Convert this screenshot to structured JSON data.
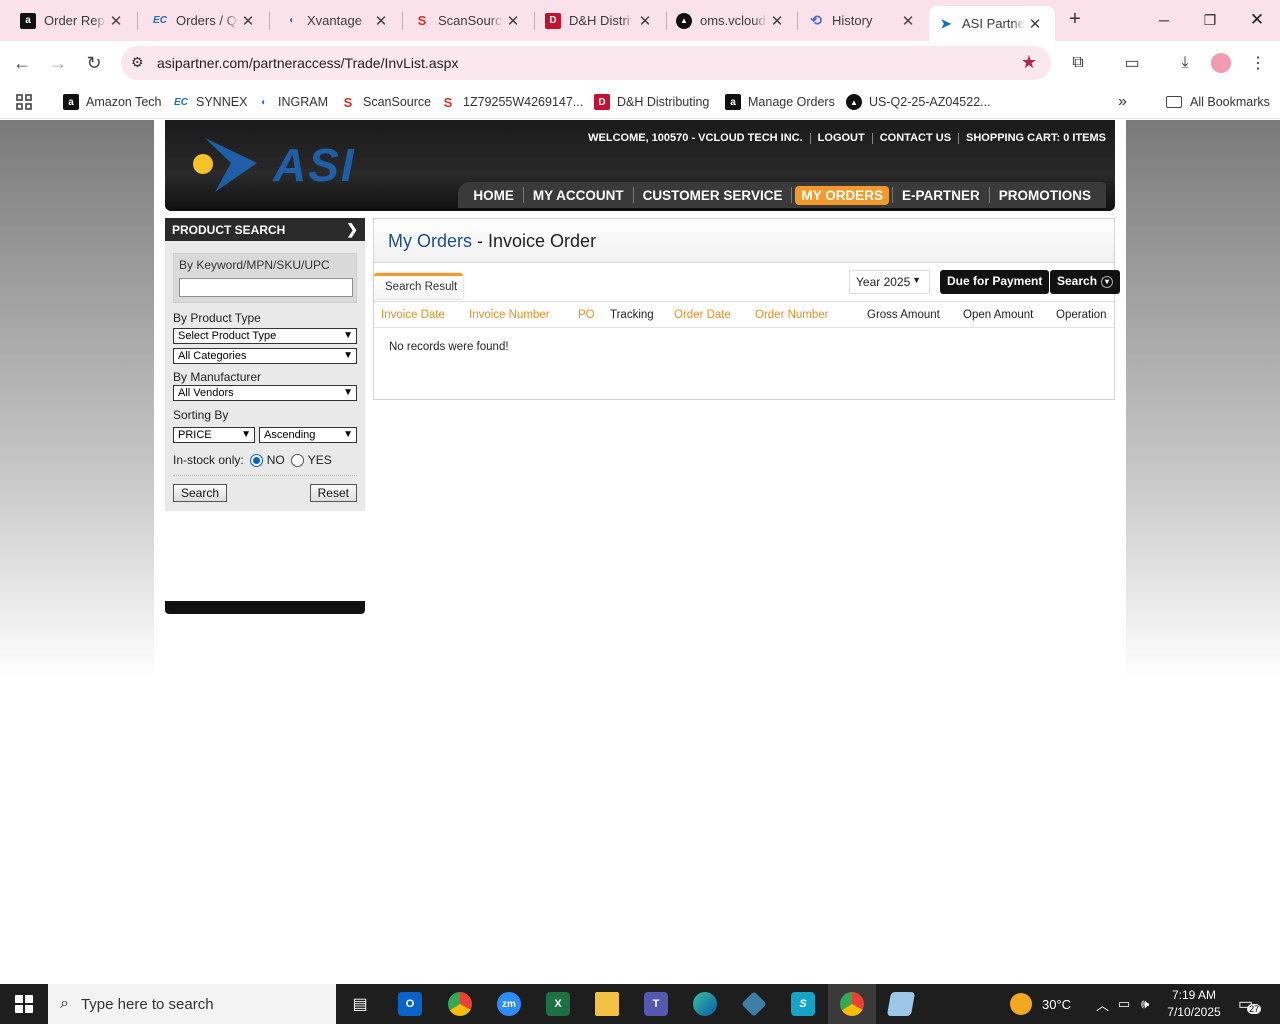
{
  "browser": {
    "tabs": [
      {
        "title": "Order Repo",
        "icon": "amazon-icon",
        "icon_glyph": "a",
        "icon_bg": "#111111",
        "icon_fg": "#ffffff"
      },
      {
        "title": "Orders / Qu",
        "icon": "synnex-icon",
        "icon_glyph": "EC",
        "icon_bg": "transparent",
        "icon_fg": "#1f6fc1"
      },
      {
        "title": "Xvantage",
        "icon": "ingram-icon",
        "icon_glyph": "◖",
        "icon_bg": "transparent",
        "icon_fg": "#1f6fc1"
      },
      {
        "title": "ScanSource",
        "icon": "scansource-icon",
        "icon_glyph": "S",
        "icon_bg": "transparent",
        "icon_fg": "#d2322d"
      },
      {
        "title": "D&H Distri",
        "icon": "dh-icon",
        "icon_glyph": "D",
        "icon_bg": "#c3122f",
        "icon_fg": "#ffffff"
      },
      {
        "title": "oms.vcloud",
        "icon": "oms-icon",
        "icon_glyph": "▲",
        "icon_bg": "#111111",
        "icon_fg": "#ffffff"
      },
      {
        "title": "History",
        "icon": "history-icon",
        "icon_glyph": "⟲",
        "icon_bg": "transparent",
        "icon_fg": "#4a6fd0"
      },
      {
        "title": "ASI Partner",
        "icon": "asi-icon",
        "icon_glyph": "➤",
        "icon_bg": "transparent",
        "icon_fg": "#1f6fc1"
      }
    ],
    "new_tab": "+",
    "url": "asipartner.com/partneraccess/Trade/InvList.aspx",
    "bookmarks": [
      {
        "label": "Amazon Tech",
        "icon": "amazon-icon",
        "glyph": "a",
        "bg": "#111111",
        "fg": "#ffffff"
      },
      {
        "label": "SYNNEX",
        "icon": "synnex-icon",
        "glyph": "EC",
        "bg": "transparent",
        "fg": "#1f6fc1"
      },
      {
        "label": "INGRAM",
        "icon": "ingram-icon",
        "glyph": "◖",
        "bg": "transparent",
        "fg": "#1f6fc1"
      },
      {
        "label": "ScanSource",
        "icon": "scansource-icon",
        "glyph": "S",
        "bg": "transparent",
        "fg": "#d2322d"
      },
      {
        "label": "1Z79255W4269147...",
        "icon": "scansource-icon",
        "glyph": "S",
        "bg": "transparent",
        "fg": "#d2322d"
      },
      {
        "label": "D&H Distributing",
        "icon": "dh-icon",
        "glyph": "D",
        "bg": "#c3122f",
        "fg": "#ffffff"
      },
      {
        "label": "Manage Orders",
        "icon": "amazon-icon",
        "glyph": "a",
        "bg": "#111111",
        "fg": "#ffffff"
      },
      {
        "label": "US-Q2-25-AZ04522...",
        "icon": "oms-icon",
        "glyph": "▲",
        "bg": "#111111",
        "fg": "#ffffff"
      }
    ],
    "more_bookmarks": "»",
    "all_bookmarks": "All Bookmarks"
  },
  "site": {
    "welcome": "WELCOME, 100570 - VCLOUD TECH INC.",
    "logout": "LOGOUT",
    "contact": "CONTACT US",
    "cart": "SHOPPING CART: 0 ITEMS",
    "logo_text": "ASI",
    "nav": [
      "HOME",
      "MY ACCOUNT",
      "CUSTOMER SERVICE",
      "MY ORDERS",
      "E-PARTNER",
      "PROMOTIONS"
    ],
    "nav_active": "MY ORDERS",
    "accent_color": "#f39a2b",
    "brand_blue": "#1f5fa8"
  },
  "sidebar": {
    "title": "PRODUCT SEARCH",
    "keyword_label": "By Keyword/MPN/SKU/UPC",
    "keyword_value": "",
    "product_type_label": "By Product Type",
    "product_type_value": "Select Product Type",
    "category_value": "All Categories",
    "manufacturer_label": "By Manufacturer",
    "manufacturer_value": "All Vendors",
    "sorting_label": "Sorting By",
    "sort_field": "PRICE",
    "sort_order": "Ascending",
    "instock_label": "In-stock only:",
    "instock_no": "NO",
    "instock_yes": "YES",
    "instock_selected": "NO",
    "search_btn": "Search",
    "reset_btn": "Reset"
  },
  "main": {
    "title_link": "My Orders",
    "title_sep": " - ",
    "title_page": "Invoice Order",
    "tab_label": "Search Result",
    "year_select": "Year 2025",
    "due_btn": "Due for Payment",
    "search_btn": "Search",
    "columns": [
      {
        "label": "Invoice Date",
        "sortable": true
      },
      {
        "label": "Invoice Number",
        "sortable": true
      },
      {
        "label": "PO",
        "sortable": true
      },
      {
        "label": "Tracking",
        "sortable": false
      },
      {
        "label": "Order Date",
        "sortable": true
      },
      {
        "label": "Order Number",
        "sortable": true
      },
      {
        "label": "Gross Amount",
        "sortable": false
      },
      {
        "label": "Open Amount",
        "sortable": false
      },
      {
        "label": "Operation",
        "sortable": false
      }
    ],
    "empty_message": "No records were found!"
  },
  "taskbar": {
    "search_placeholder": "Type here to search",
    "apps": [
      "task-view",
      "outlook",
      "chrome",
      "zoom",
      "excel",
      "file-explorer",
      "teams",
      "edge",
      "app-diamond",
      "app-s",
      "chrome-active",
      "notepad"
    ],
    "temperature": "30°C",
    "time": "7:19 AM",
    "date": "7/10/2025",
    "notifications": "27"
  }
}
